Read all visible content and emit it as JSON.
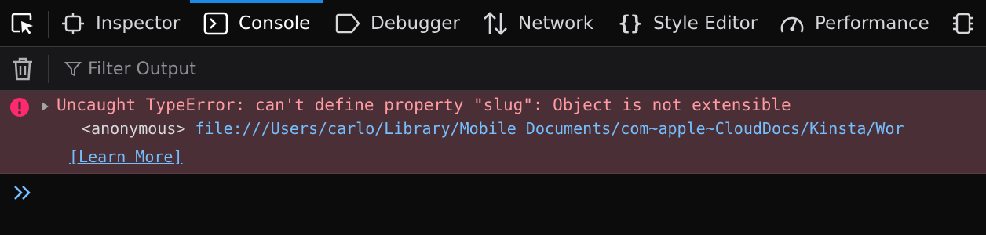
{
  "toolbar": {
    "tabs": [
      {
        "label": "Inspector",
        "icon": "inspector-icon"
      },
      {
        "label": "Console",
        "icon": "console-icon",
        "selected": true
      },
      {
        "label": "Debugger",
        "icon": "debugger-icon"
      },
      {
        "label": "Network",
        "icon": "network-icon"
      },
      {
        "label": "Style Editor",
        "icon": "style-editor-icon"
      },
      {
        "label": "Performance",
        "icon": "performance-icon"
      }
    ],
    "accent": "#1c8be8"
  },
  "filter": {
    "placeholder": "Filter Output"
  },
  "messages": [
    {
      "level": "error",
      "text": "Uncaught TypeError: can't define property \"slug\": Object is not extensible",
      "frame_function": "<anonymous>",
      "frame_location": "file:///Users/carlo/Library/Mobile Documents/com~apple~CloudDocs/Kinsta/Wor",
      "learn_more": "[Learn More]"
    }
  ],
  "colors": {
    "background": "#0c0c0d",
    "error_background": "#4b2f36",
    "error_text": "#ff9aa2",
    "link": "#75bfff",
    "error_icon": "#ff2a6d"
  }
}
